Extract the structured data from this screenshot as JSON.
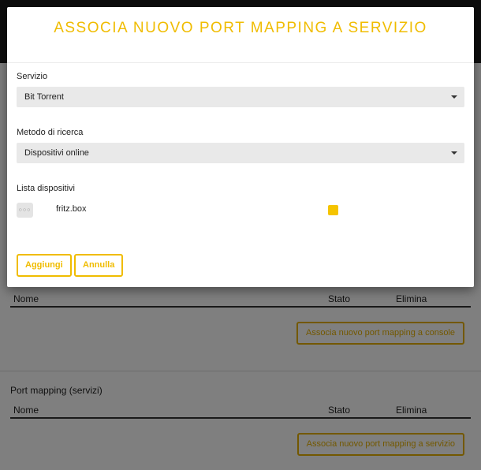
{
  "background": {
    "console_table": {
      "columns": [
        "Nome",
        "Stato",
        "Elimina"
      ],
      "add_button_label": "Associa nuovo port mapping a console"
    },
    "services_section": {
      "title": "Port mapping (servizi)",
      "columns": [
        "Nome",
        "Stato",
        "Elimina"
      ],
      "add_button_label": "Associa nuovo port mapping a servizio"
    }
  },
  "modal": {
    "title": "ASSOCIA NUOVO PORT MAPPING A SERVIZIO",
    "service": {
      "label": "Servizio",
      "selected": "Bit Torrent"
    },
    "search_method": {
      "label": "Metodo di ricerca",
      "selected": "Dispositivi online"
    },
    "device_list": {
      "label": "Lista dispositivi",
      "devices": [
        {
          "icon": "ellipsis-icon",
          "icon_glyph": "○○○",
          "name": "fritz.box",
          "checked": true
        }
      ]
    },
    "buttons": {
      "add_label": "Aggiungi",
      "cancel_label": "Annulla"
    }
  },
  "colors": {
    "accent": "#f0bc00",
    "overlay": "rgba(0,0,0,0.5)",
    "select_bg": "#e9e9e9",
    "topbar": "#1a1a1a"
  }
}
